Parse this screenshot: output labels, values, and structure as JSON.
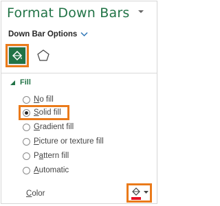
{
  "pane": {
    "title": "Format Down Bars",
    "options_label": "Down Bar Options",
    "accent": "#217346",
    "highlight": "#ea7a1a"
  },
  "tabs": [
    {
      "name": "Fill & Line",
      "icon": "paint-bucket-icon",
      "selected": true
    },
    {
      "name": "Effects",
      "icon": "pentagon-icon",
      "selected": false
    }
  ],
  "fill_section": {
    "label": "Fill",
    "expanded": true,
    "options": [
      {
        "pre": "",
        "key": "N",
        "post": "o fill",
        "checked": false
      },
      {
        "pre": "",
        "key": "S",
        "post": "olid fill",
        "checked": true
      },
      {
        "pre": "",
        "key": "G",
        "post": "radient fill",
        "checked": false
      },
      {
        "pre": "",
        "key": "P",
        "post": "icture or texture fill",
        "checked": false
      },
      {
        "pre": "P",
        "key": "a",
        "post": "ttern fill",
        "checked": false
      },
      {
        "pre": "",
        "key": "A",
        "post": "utomatic",
        "checked": false
      }
    ],
    "color_label_key": "C",
    "color_label_rest": "olor",
    "color_value": "#e81123"
  }
}
